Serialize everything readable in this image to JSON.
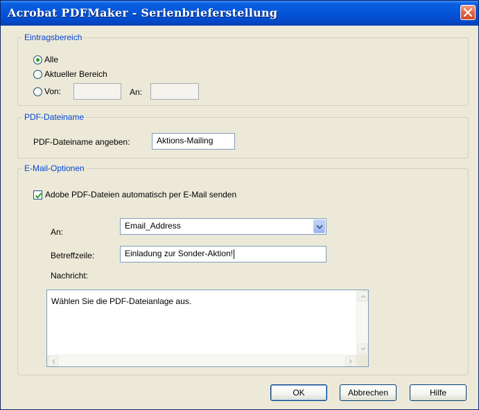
{
  "window": {
    "title": "Acrobat PDFMaker - Serienbrieferstellung"
  },
  "entry_range": {
    "legend": "Eintragsbereich",
    "options": [
      {
        "label": "Alle",
        "selected": true
      },
      {
        "label": "Aktueller Bereich",
        "selected": false
      },
      {
        "label": "Von:",
        "selected": false
      }
    ],
    "from_value": "",
    "to_label": "An:",
    "to_value": ""
  },
  "pdf_name": {
    "legend": "PDF-Dateiname",
    "label": "PDF-Dateiname angeben:",
    "value": "Aktions-Mailing"
  },
  "email": {
    "legend": "E-Mail-Optionen",
    "auto_send_label": "Adobe PDF-Dateien automatisch per E-Mail senden",
    "auto_send_checked": true,
    "to_label": "An:",
    "to_value": "Email_Address",
    "subject_label": "Betreffzeile:",
    "subject_value": "Einladung zur Sonder-Aktion!",
    "message_label": "Nachricht:",
    "message_value": "Wählen Sie die PDF-Dateianlage aus."
  },
  "buttons": {
    "ok": "OK",
    "cancel": "Abbrechen",
    "help": "Hilfe"
  },
  "colors": {
    "legend_text": "#0046d5",
    "titlebar": "#0554d8",
    "check": "#21a121"
  }
}
